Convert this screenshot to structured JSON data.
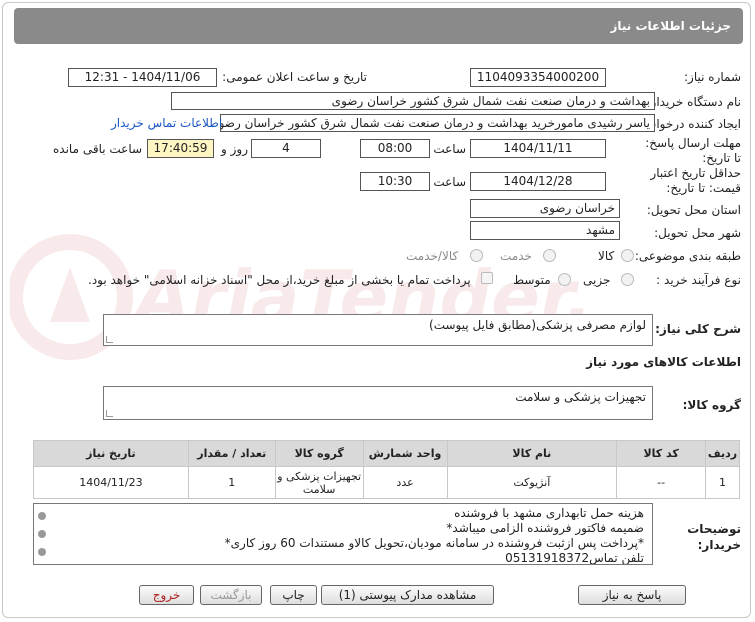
{
  "header": {
    "title": "جزئیات اطلاعات نیاز"
  },
  "fields": {
    "need_number_label": "شماره نیاز:",
    "need_number": "1104093354000200",
    "announce_label": "تاریخ و ساعت اعلان عمومی:",
    "announce_value": "1404/11/06 - 12:31",
    "buyer_org_label": "نام دستگاه خریدار:",
    "buyer_org": "بهداشت و درمان صنعت نفت شمال شرق کشور   خراسان رضوی",
    "requester_label": "ایجاد کننده درخواست:",
    "requester": "یاسر رشیدی مامورخرید بهداشت و درمان صنعت نفت شمال شرق کشور   خراسان رضوی",
    "contact_link": "اطلاعات تماس خریدار",
    "deadline_label": "مهلت ارسال پاسخ: تا تاریخ:",
    "deadline_date": "1404/11/11",
    "time_label": "ساعت",
    "deadline_time": "08:00",
    "days_value": "4",
    "days_label": "روز و",
    "remaining_time": "17:40:59",
    "remaining_label": "ساعت باقی مانده",
    "validity_label": "حداقل تاریخ اعتبار قیمت: تا تاریخ:",
    "validity_date": "1404/12/28",
    "validity_time": "10:30",
    "province_label": "استان محل تحویل:",
    "province": "خراسان رضوی",
    "city_label": "شهر محل تحویل:",
    "city": "مشهد",
    "category_label": "طبقه بندی موضوعی:",
    "category_options": [
      "کالا",
      "خدمت",
      "کالا/خدمت"
    ],
    "process_label": "نوع فرآیند خرید :",
    "process_options": [
      "جزیی",
      "متوسط"
    ],
    "payment_note": "پرداخت تمام یا بخشی از مبلغ خرید،از محل \"اسناد خزانه اسلامی\" خواهد بود."
  },
  "description": {
    "label": "شرح کلی نیاز:",
    "value": "لوازم مصرفی پزشکی(مطابق فایل پیوست)"
  },
  "goods_info": {
    "title": "اطلاعات کالاهای مورد نیاز",
    "group_label": "گروه کالا:",
    "group_value": "تجهیزات پزشکی و سلامت"
  },
  "table": {
    "headers": [
      "ردیف",
      "کد کالا",
      "نام کالا",
      "واحد شمارش",
      "گروه کالا",
      "تعداد / مقدار",
      "تاریخ نیاز"
    ],
    "rows": [
      [
        "1",
        "--",
        "آنژیوکت",
        "عدد",
        "تجهیزات پزشکی و سلامت",
        "1",
        "1404/11/23"
      ]
    ]
  },
  "buyer_notes": {
    "label": "توضیحات خریدار:",
    "lines": [
      "هزینه حمل تابهداری مشهد با فروشنده",
      "ضمیمه فاکتور فروشنده الزامی میباشد*",
      "*پرداخت پس ازثبت فروشنده در سامانه مودیان،تحویل کالاو مستندات 60 روز کاری*",
      "تلفن تماس05131918372"
    ]
  },
  "buttons": {
    "reply": "پاسخ به نیاز",
    "view_docs": "مشاهده مدارک پیوستی (1)",
    "print": "چاپ",
    "back": "بازگشت",
    "exit": "خروج"
  },
  "watermark": {
    "text": "AriaTender.net"
  },
  "colors": {
    "header_bg": "#8a8a8a",
    "link": "#1a56c4",
    "highlight": "#fdf5c2",
    "exit_text": "#b01e1e"
  }
}
